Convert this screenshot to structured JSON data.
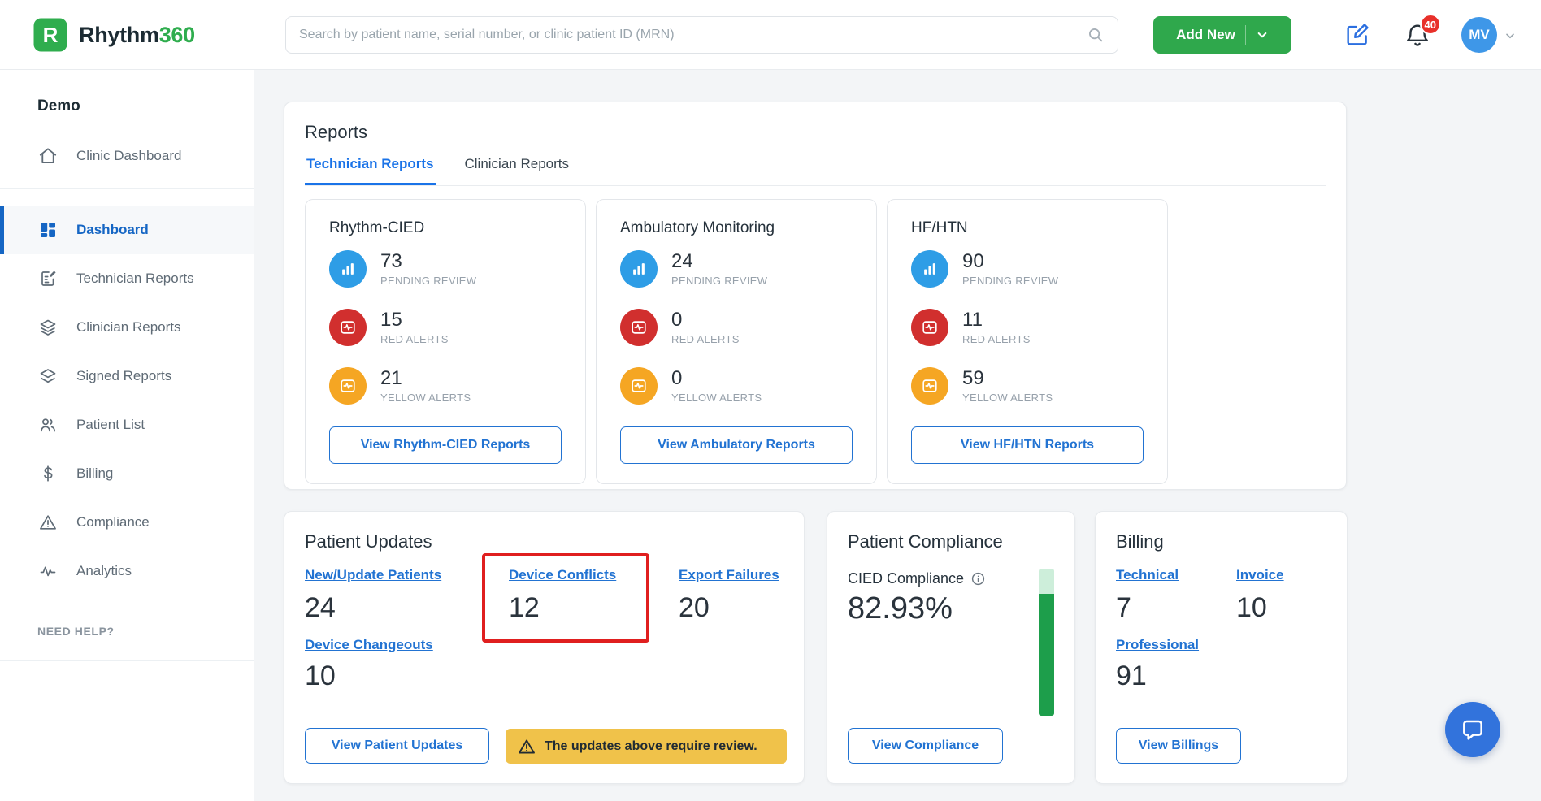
{
  "header": {
    "brand_primary": "Rhythm",
    "brand_secondary": "360",
    "search_placeholder": "Search by patient name, serial number, or clinic patient ID (MRN)",
    "add_new_label": "Add New",
    "notification_count": "40",
    "avatar_initials": "MV"
  },
  "sidebar": {
    "org_name": "Demo",
    "clinic_item": "Clinic Dashboard",
    "items": [
      {
        "label": "Dashboard"
      },
      {
        "label": "Technician Reports"
      },
      {
        "label": "Clinician Reports"
      },
      {
        "label": "Signed Reports"
      },
      {
        "label": "Patient List"
      },
      {
        "label": "Billing"
      },
      {
        "label": "Compliance"
      },
      {
        "label": "Analytics"
      }
    ],
    "help_label": "NEED HELP?"
  },
  "reports": {
    "title": "Reports",
    "tabs": [
      {
        "label": "Technician Reports"
      },
      {
        "label": "Clinician Reports"
      }
    ],
    "cards": [
      {
        "title": "Rhythm-CIED",
        "pending": {
          "value": "73",
          "label": "PENDING REVIEW"
        },
        "red": {
          "value": "15",
          "label": "RED ALERTS"
        },
        "yellow": {
          "value": "21",
          "label": "YELLOW ALERTS"
        },
        "button": "View Rhythm-CIED Reports"
      },
      {
        "title": "Ambulatory Monitoring",
        "pending": {
          "value": "24",
          "label": "PENDING REVIEW"
        },
        "red": {
          "value": "0",
          "label": "RED ALERTS"
        },
        "yellow": {
          "value": "0",
          "label": "YELLOW ALERTS"
        },
        "button": "View Ambulatory Reports"
      },
      {
        "title": "HF/HTN",
        "pending": {
          "value": "90",
          "label": "PENDING REVIEW"
        },
        "red": {
          "value": "11",
          "label": "RED ALERTS"
        },
        "yellow": {
          "value": "59",
          "label": "YELLOW ALERTS"
        },
        "button": "View HF/HTN Reports"
      }
    ]
  },
  "patient_updates": {
    "title": "Patient Updates",
    "new_update": {
      "label": "New/Update Patients",
      "value": "24"
    },
    "device_conflicts": {
      "label": "Device Conflicts",
      "value": "12"
    },
    "export_failures": {
      "label": "Export Failures",
      "value": "20"
    },
    "device_changeouts": {
      "label": "Device Changeouts",
      "value": "10"
    },
    "button": "View Patient Updates",
    "warning": "The updates above require review."
  },
  "patient_compliance": {
    "title": "Patient Compliance",
    "metric_label": "CIED Compliance",
    "value": "82.93%",
    "percent": 82.93,
    "button": "View Compliance"
  },
  "billing": {
    "title": "Billing",
    "technical": {
      "label": "Technical",
      "value": "7"
    },
    "invoice": {
      "label": "Invoice",
      "value": "10"
    },
    "professional": {
      "label": "Professional",
      "value": "91"
    },
    "button": "View Billings"
  },
  "colors": {
    "brand_green": "#2fad4e",
    "link_blue": "#2273d2",
    "tab_blue": "#1a73e8",
    "pending_blue": "#2e9de6",
    "alert_red": "#d12f2e",
    "alert_yellow": "#f5a623",
    "warning_banner_yellow": "#f0c24a",
    "highlight_red": "#e01f1f",
    "compliance_green": "#1d9e4b"
  }
}
